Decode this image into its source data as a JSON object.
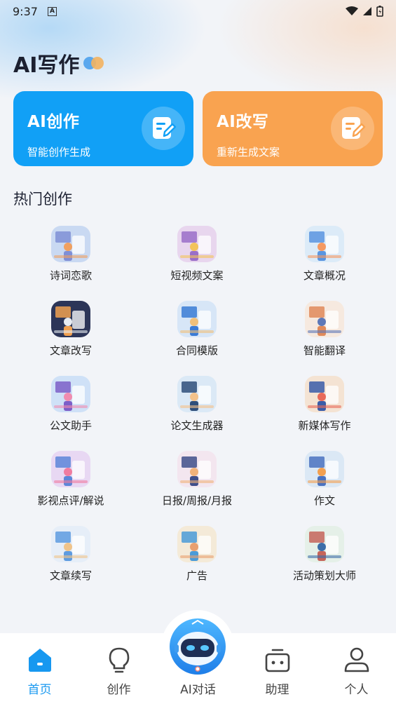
{
  "status_bar": {
    "time": "9:37",
    "notif_icon": "A"
  },
  "page_title": "AI写作",
  "cards": [
    {
      "title": "AI创作",
      "subtitle": "智能创作生成",
      "icon": "edit-doc-icon",
      "color": "#11a0f6"
    },
    {
      "title": "AI改写",
      "subtitle": "重新生成文案",
      "icon": "edit-doc-icon",
      "color": "#f9a350"
    }
  ],
  "section_title": "热门创作",
  "hot_items": [
    {
      "label": "诗词恋歌"
    },
    {
      "label": "短视频文案"
    },
    {
      "label": "文章概况"
    },
    {
      "label": "文章改写"
    },
    {
      "label": "合同模版"
    },
    {
      "label": "智能翻译"
    },
    {
      "label": "公文助手"
    },
    {
      "label": "论文生成器"
    },
    {
      "label": "新媒体写作"
    },
    {
      "label": "影视点评/解说"
    },
    {
      "label": "日报/周报/月报"
    },
    {
      "label": "作文"
    },
    {
      "label": "文章续写"
    },
    {
      "label": "广告"
    },
    {
      "label": "活动策划大师"
    }
  ],
  "tabs": [
    {
      "label": "首页",
      "icon": "home-icon",
      "active": true
    },
    {
      "label": "创作",
      "icon": "lightbulb-icon",
      "active": false
    },
    {
      "label": "AI对话",
      "icon": "robot-icon",
      "active": false
    },
    {
      "label": "助理",
      "icon": "assistant-icon",
      "active": false
    },
    {
      "label": "个人",
      "icon": "person-icon",
      "active": false
    }
  ],
  "colors": {
    "accent": "#1798f0",
    "blue_card": "#11a0f6",
    "orange_card": "#f9a350"
  }
}
